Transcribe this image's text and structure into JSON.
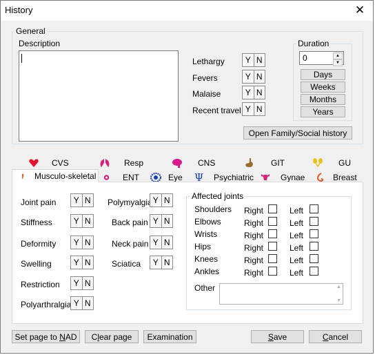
{
  "window": {
    "title": "History",
    "close_glyph": "✕"
  },
  "general": {
    "group_label": "General",
    "description_label": "Description",
    "description_value": "",
    "symptoms": [
      {
        "label": "Lethargy",
        "yes": "Y",
        "no": "N"
      },
      {
        "label": "Fevers",
        "yes": "Y",
        "no": "N"
      },
      {
        "label": "Malaise",
        "yes": "Y",
        "no": "N"
      },
      {
        "label": "Recent travel",
        "yes": "Y",
        "no": "N"
      }
    ],
    "duration": {
      "label": "Duration",
      "value": "0",
      "units": [
        "Days",
        "Weeks",
        "Months",
        "Years"
      ]
    },
    "open_family_btn": "Open Family/Social history"
  },
  "tabs": {
    "row1": [
      {
        "label": "CVS",
        "icon": "heart-icon"
      },
      {
        "label": "Resp",
        "icon": "lungs-icon"
      },
      {
        "label": "CNS",
        "icon": "brain-icon"
      },
      {
        "label": "GIT",
        "icon": "stomach-icon"
      },
      {
        "label": "GU",
        "icon": "kidney-icon"
      }
    ],
    "row2": [
      {
        "label": "Musculo-skeletal",
        "icon": "bone-icon",
        "active": true
      },
      {
        "label": "ENT",
        "icon": "ear-icon"
      },
      {
        "label": "Eye",
        "icon": "eye-icon"
      },
      {
        "label": "Psychiatric",
        "icon": "psi-icon"
      },
      {
        "label": "Gynae",
        "icon": "uterus-icon"
      },
      {
        "label": "Breast",
        "icon": "breast-icon"
      }
    ]
  },
  "musculo": {
    "left_col": [
      {
        "label": "Joint pain",
        "yes": "Y",
        "no": "N"
      },
      {
        "label": "Stiffness",
        "yes": "Y",
        "no": "N"
      },
      {
        "label": "Deformity",
        "yes": "Y",
        "no": "N"
      },
      {
        "label": "Swelling",
        "yes": "Y",
        "no": "N"
      },
      {
        "label": "Restriction",
        "yes": "Y",
        "no": "N"
      },
      {
        "label": "Polyarthralgia",
        "yes": "Y",
        "no": "N"
      }
    ],
    "mid_col": [
      {
        "label": "Polymyalgia",
        "yes": "Y",
        "no": "N"
      },
      {
        "label": "Back pain",
        "yes": "Y",
        "no": "N"
      },
      {
        "label": "Neck pain",
        "yes": "Y",
        "no": "N"
      },
      {
        "label": "Sciatica",
        "yes": "Y",
        "no": "N"
      }
    ],
    "affected": {
      "group_label": "Affected joints",
      "joints": [
        {
          "name": "Shoulders",
          "right": "Right",
          "left": "Left"
        },
        {
          "name": "Elbows",
          "right": "Right",
          "left": "Left"
        },
        {
          "name": "Wrists",
          "right": "Right",
          "left": "Left"
        },
        {
          "name": "Hips",
          "right": "Right",
          "left": "Left"
        },
        {
          "name": "Knees",
          "right": "Right",
          "left": "Left"
        },
        {
          "name": "Ankles",
          "right": "Right",
          "left": "Left"
        }
      ],
      "other_label": "Other",
      "other_value": ""
    }
  },
  "footer": {
    "set_page_pre": "Set page to ",
    "set_page_key": "N",
    "set_page_post": "AD",
    "clear_pre": "C",
    "clear_key": "l",
    "clear_post": "ear page",
    "examination": "Examination",
    "save_key": "S",
    "save_post": "ave",
    "cancel_key": "C",
    "cancel_post": "ancel"
  },
  "colors": {
    "heart": "#e8112d",
    "lungs": "#d6237a",
    "brain": "#d81b8c",
    "stomach": "#9a6b2e",
    "kidney": "#e6c21c",
    "bone": "#e0561b",
    "eye": "#1a3fb0",
    "psi": "#1a3fb0",
    "uterus": "#d6237a",
    "breast": "#e0561b"
  }
}
